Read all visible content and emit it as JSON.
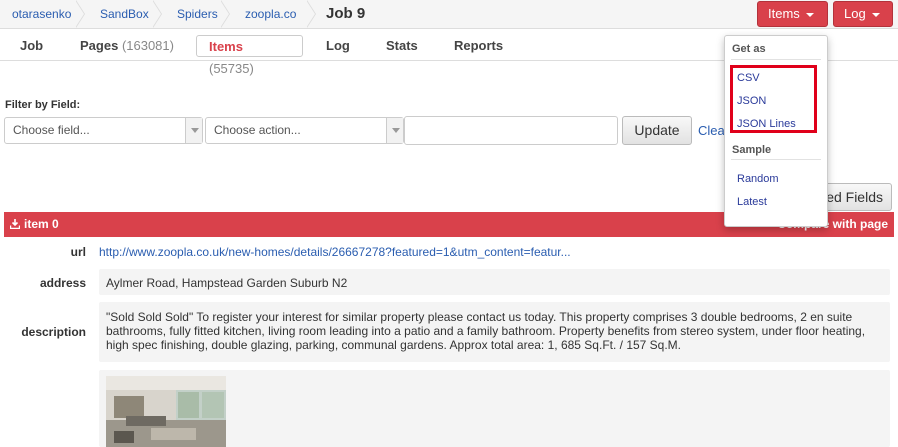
{
  "breadcrumb": {
    "items": [
      "otarasenko",
      "SandBox",
      "Spiders",
      "zoopla.co"
    ],
    "current": "Job 9"
  },
  "header_buttons": {
    "items_label": "Items",
    "log_label": "Log"
  },
  "tabs": [
    {
      "label": "Job",
      "count": ""
    },
    {
      "label": "Pages",
      "count": "(163081)"
    },
    {
      "label": "Items",
      "count": "(55735)"
    },
    {
      "label": "Log",
      "count": ""
    },
    {
      "label": "Stats",
      "count": ""
    },
    {
      "label": "Reports",
      "count": ""
    }
  ],
  "active_tab": "Items",
  "filter": {
    "label": "Filter by Field:",
    "field_select": "Choose field...",
    "action_select": "Choose action...",
    "value": "",
    "update_label": "Update",
    "clear_label": "Clea"
  },
  "fields_button_label": "ed Fields",
  "item": {
    "title": "item 0",
    "compare_label": "Compare with page",
    "fields": {
      "url_label": "url",
      "url_value": "http://www.zoopla.co.uk/new-homes/details/26667278?featured=1&utm_content=featur...",
      "address_label": "address",
      "address_value": "Aylmer Road, Hampstead Garden Suburb N2",
      "description_label": "description",
      "description_value": "\"Sold Sold Sold\" To register your interest for similar property please contact us today. This property comprises 3 double bedrooms, 2 en suite bathrooms, fully fitted kitchen, living room leading into a patio and a family bathroom. Property benefits from stereo system, under floor heating, high spec finishing, double glazing, parking, communal gardens. Approx total area: 1, 685 Sq.Ft. / 157 Sq.M."
    }
  },
  "dropdown": {
    "get_as_header": "Get as",
    "get_as_items": [
      "CSV",
      "JSON",
      "JSON Lines"
    ],
    "sample_header": "Sample",
    "sample_items": [
      "Random",
      "Latest"
    ]
  },
  "colors": {
    "accent_red": "#d9414b",
    "link_blue": "#2a5db0",
    "highlight_red": "#e0001a"
  }
}
